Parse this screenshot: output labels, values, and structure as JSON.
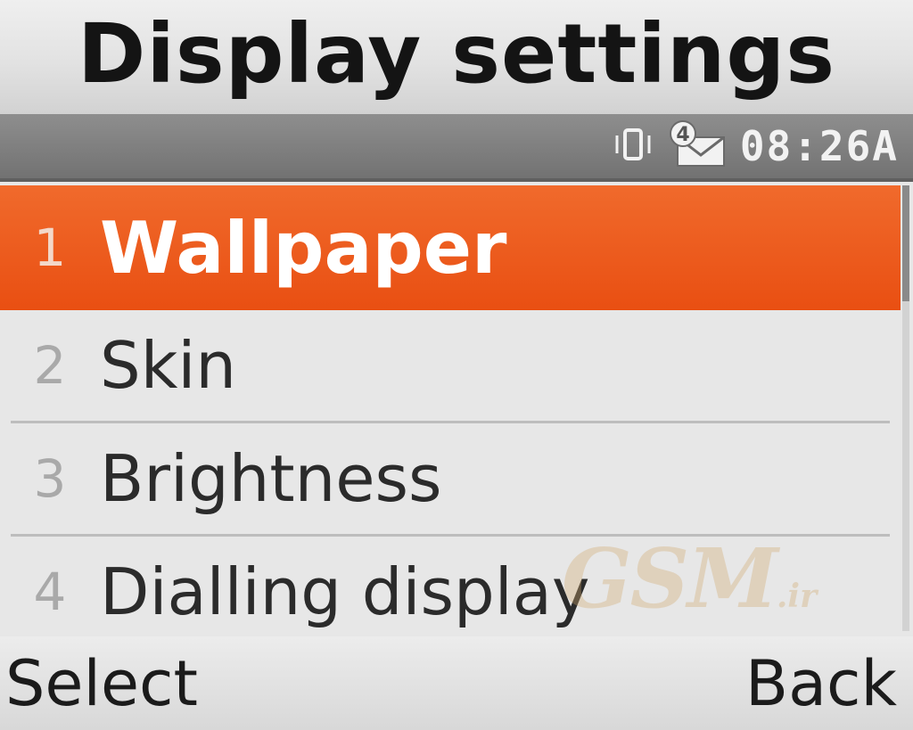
{
  "header": {
    "title": "Display settings"
  },
  "status": {
    "time": "08:26A",
    "icons": [
      "vibrate-icon",
      "message-envelope-icon"
    ],
    "message_badge": "4"
  },
  "menu": {
    "items": [
      {
        "number": "1",
        "label": "Wallpaper",
        "selected": true
      },
      {
        "number": "2",
        "label": "Skin",
        "selected": false
      },
      {
        "number": "3",
        "label": "Brightness",
        "selected": false
      },
      {
        "number": "4",
        "label": "Dialling display",
        "selected": false
      }
    ]
  },
  "watermark": {
    "text": "GSM",
    "suffix": ".ir"
  },
  "softkeys": {
    "left": "Select",
    "right": "Back"
  },
  "colors": {
    "selection": "#e94f12",
    "status_bar": "#7f7f7f",
    "background": "#e7e7e7"
  }
}
